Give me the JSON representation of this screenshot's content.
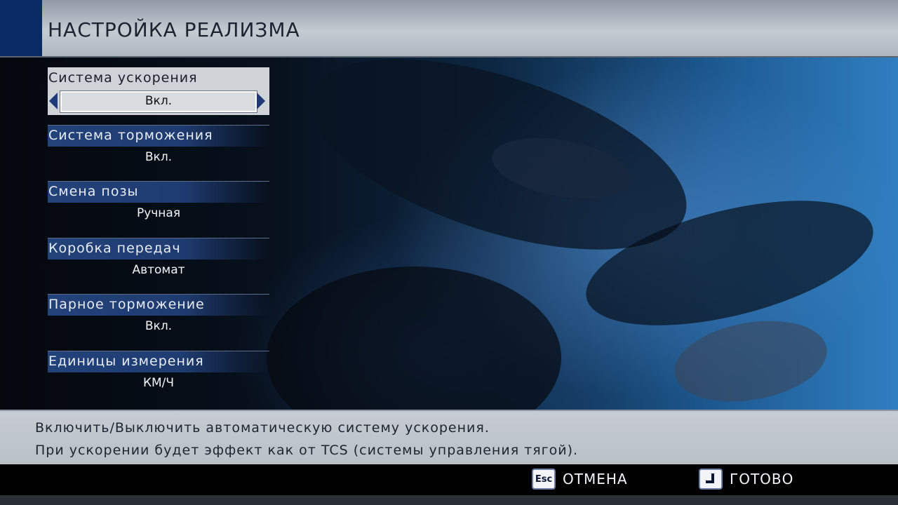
{
  "screen": {
    "title": "НАСТРОЙКА РЕАЛИЗМА"
  },
  "menu": {
    "items": [
      {
        "label": "Система ускорения",
        "value": "Вкл."
      },
      {
        "label": "Система торможения",
        "value": "Вкл."
      },
      {
        "label": "Смена позы",
        "value": "Ручная"
      },
      {
        "label": "Коробка передач",
        "value": "Автомат"
      },
      {
        "label": "Парное торможение",
        "value": "Вкл."
      },
      {
        "label": "Единицы измерения",
        "value": "КМ/Ч"
      }
    ]
  },
  "description": {
    "line1": "Включить/Выключить автоматическую систему ускорения.",
    "line2": "При ускорении будет эффект как от TCS (системы управления тягой)."
  },
  "footer": {
    "cancel_key": "Esc",
    "cancel_label": "ОТМЕНА",
    "ok_label": "ГОТОВО"
  },
  "colors": {
    "accent": "#0a2a66",
    "label_bar": "#22427a",
    "selected_bg": "#cfd3d8"
  }
}
